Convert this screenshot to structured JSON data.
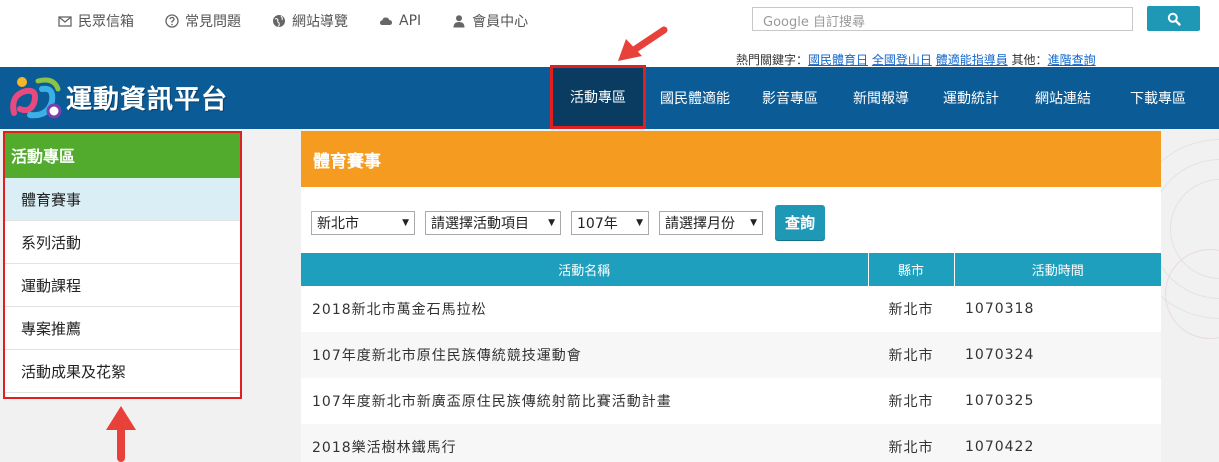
{
  "util_links": [
    {
      "label": "民眾信箱",
      "icon": "mail-icon"
    },
    {
      "label": "常見問題",
      "icon": "question-icon"
    },
    {
      "label": "網站導覽",
      "icon": "globe-icon"
    },
    {
      "label": "API",
      "icon": "cloud-icon"
    },
    {
      "label": "會員中心",
      "icon": "user-icon"
    }
  ],
  "search": {
    "placeholder": "Google 自訂搜尋",
    "icon": "search-icon"
  },
  "hot_keywords": {
    "prefix": "熱門關鍵字：",
    "items": [
      "國民體育日",
      "全國登山日",
      "體適能指導員"
    ],
    "other_prefix": "其他：",
    "other": "進階查詢"
  },
  "logo": {
    "text": "運動資訊平台"
  },
  "nav": [
    "活動專區",
    "國民體適能",
    "影音專區",
    "新聞報導",
    "運動統計",
    "網站連結",
    "下載專區"
  ],
  "sidebar": {
    "title": "活動專區",
    "items": [
      "體育賽事",
      "系列活動",
      "運動課程",
      "專案推薦",
      "活動成果及花絮"
    ]
  },
  "panel": {
    "title": "體育賽事",
    "filters": {
      "city": "新北市",
      "item": "請選擇活動項目",
      "year": "107年",
      "month": "請選擇月份"
    },
    "query_label": "查詢",
    "columns": [
      "活動名稱",
      "縣市",
      "活動時間"
    ],
    "rows": [
      {
        "name": "2018新北市萬金石馬拉松",
        "city": "新北市",
        "date": "1070318"
      },
      {
        "name": "107年度新北市原住民族傳統競技運動會",
        "city": "新北市",
        "date": "1070324"
      },
      {
        "name": "107年度新北市新廣盃原住民族傳統射箭比賽活動計畫",
        "city": "新北市",
        "date": "1070325"
      },
      {
        "name": "2018樂活樹林鐵馬行",
        "city": "新北市",
        "date": "1070422"
      }
    ]
  },
  "colors": {
    "nav_bg": "#0b5b96",
    "sidebar_head": "#52ab2c",
    "panel_head": "#f59b1f",
    "table_head": "#1e9fbd",
    "annotation": "#e02020"
  }
}
